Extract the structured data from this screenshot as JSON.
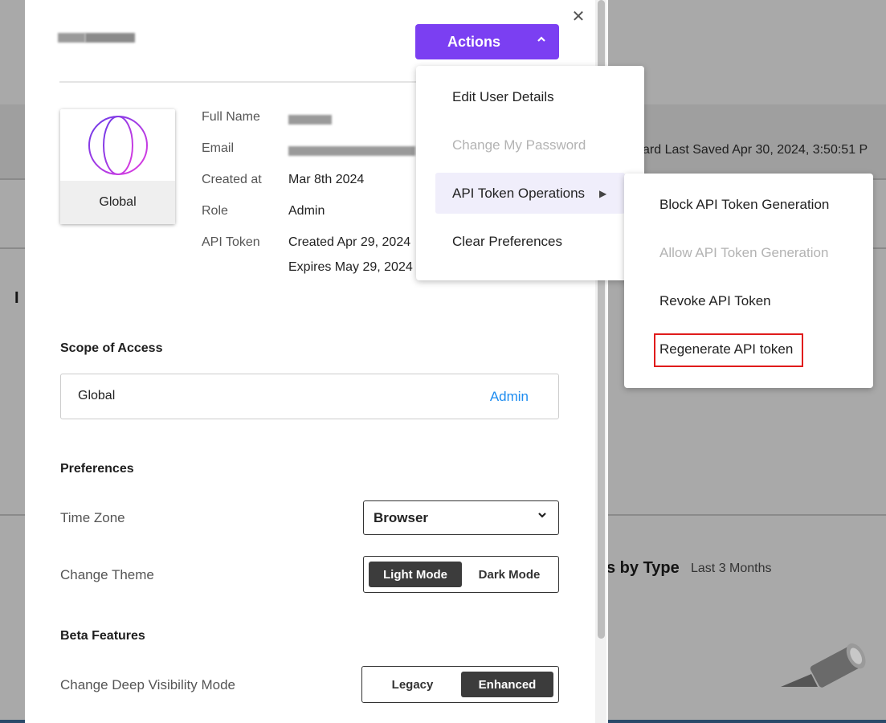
{
  "user": {
    "display_name": ""
  },
  "actions": {
    "label": "Actions"
  },
  "profile": {
    "card_label": "Global",
    "fields": {
      "full_name_label": "Full Name",
      "email_label": "Email",
      "created_label": "Created at",
      "created_value": "Mar 8th 2024",
      "role_label": "Role",
      "role_value": "Admin",
      "api_token_label": "API Token",
      "api_token_created": "Created Apr 29, 2024",
      "api_token_expires": "Expires May 29, 2024"
    }
  },
  "scope": {
    "heading": "Scope of Access",
    "row": {
      "name": "Global",
      "role": "Admin"
    }
  },
  "preferences": {
    "heading": "Preferences",
    "time_zone_label": "Time Zone",
    "time_zone_value": "Browser",
    "theme_label": "Change Theme",
    "theme_options": [
      "Light Mode",
      "Dark Mode"
    ],
    "theme_selected": "Light Mode"
  },
  "beta": {
    "heading": "Beta Features",
    "deep_visibility_label": "Change Deep Visibility Mode",
    "deep_visibility_options": [
      "Legacy",
      "Enhanced"
    ],
    "deep_visibility_selected": "Enhanced"
  },
  "actions_menu": {
    "items": [
      {
        "label": "Edit User Details",
        "disabled": false
      },
      {
        "label": "Change My Password",
        "disabled": true
      },
      {
        "label": "API Token Operations",
        "disabled": false,
        "has_submenu": true
      },
      {
        "label": "Clear Preferences",
        "disabled": false
      }
    ]
  },
  "token_submenu": {
    "items": [
      {
        "label": "Block API Token Generation",
        "disabled": false
      },
      {
        "label": "Allow API Token Generation",
        "disabled": true
      },
      {
        "label": "Revoke API Token",
        "disabled": false
      },
      {
        "label": "Regenerate API token",
        "disabled": false,
        "highlighted": true
      }
    ]
  },
  "background": {
    "saved_text": "ard Last Saved Apr 30, 2024, 3:50:51 P",
    "left_fragment": "I",
    "chart_title": "s by Type",
    "chart_subtitle": "Last 3 Months"
  },
  "colors": {
    "accent": "#7b3ff2",
    "link": "#1d8cf0",
    "highlight_border": "#e01b1b"
  },
  "icons": [
    "close-icon",
    "chevron-up-icon",
    "globe-icon",
    "chevron-down-icon",
    "caret-right-icon"
  ]
}
